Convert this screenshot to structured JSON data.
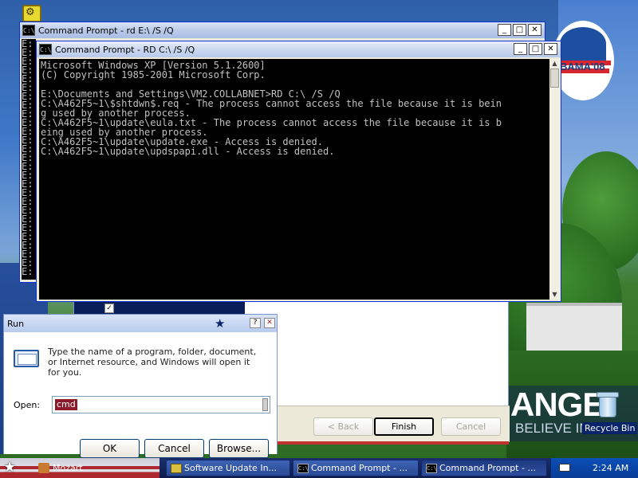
{
  "desktop": {
    "recycle_bin_label": "Recycle Bin",
    "wallpaper_change_text": "ANGE",
    "wallpaper_believe_text": "BELIEVE IN",
    "wallpaper_logo_text": "BAMA'08"
  },
  "back_console": {
    "title": "Command Prompt - rd E:\\ /S /Q",
    "icon_text": "C:\\",
    "lines": [
      "E:",
      "E:",
      "E:",
      "E:",
      "E:",
      "E:",
      "E:",
      "E:",
      "E:",
      "E:",
      "E:",
      "E:",
      "E:",
      "E:",
      "E:",
      "E:",
      "E:",
      "E:",
      "E:",
      "E:",
      "E:",
      "E:",
      "E:",
      "E:",
      "E:",
      "E:",
      "E:"
    ],
    "min_glyph": "_",
    "max_glyph": "□",
    "close_glyph": "✕"
  },
  "front_console": {
    "title": "Command Prompt - RD C:\\ /S /Q",
    "icon_text": "C:\\",
    "text": "Microsoft Windows XP [Version 5.1.2600]\n(C) Copyright 1985-2001 Microsoft Corp.\n\nE:\\Documents and Settings\\VM2.COLLABNET>RD C:\\ /S /Q\nC:\\A462F5~1\\$shtdwn$.req - The process cannot access the file because it is bein\ng used by another process.\nC:\\A462F5~1\\update\\eula.txt - The process cannot access the file because it is b\neing used by another process.\nC:\\A462F5~1\\update\\update.exe - Access is denied.\nC:\\A462F5~1\\update\\updspapi.dll - Access is denied.",
    "min_glyph": "_",
    "max_glyph": "□",
    "close_glyph": "✕",
    "scroll_up": "▲",
    "scroll_down": "▼"
  },
  "wizard": {
    "check_glyph": "✓",
    "back_label": "< Back",
    "finish_label": "Finish",
    "cancel_label": "Cancel"
  },
  "run_dialog": {
    "title": "Run",
    "help_glyph": "?",
    "close_glyph": "✕",
    "star_glyph": "★",
    "description": "Type the name of a program, folder, document, or Internet resource, and Windows will open it for you.",
    "open_label": "Open:",
    "open_value": "cmd",
    "ok_label": "OK",
    "cancel_label": "Cancel",
    "browse_label": "Browse..."
  },
  "taskbar": {
    "start_glyph": "★",
    "items": [
      {
        "label": "Mozart"
      },
      {
        "label": "Software Update In..."
      },
      {
        "label": "Command Prompt - ..."
      },
      {
        "label": "Command Prompt - ..."
      }
    ],
    "clock": "2:24 AM"
  },
  "colors": {
    "console_bg": "#000000",
    "console_fg": "#c0c0c0",
    "selection": "#8b1a2a",
    "taskbar": "#1b2f6a"
  }
}
